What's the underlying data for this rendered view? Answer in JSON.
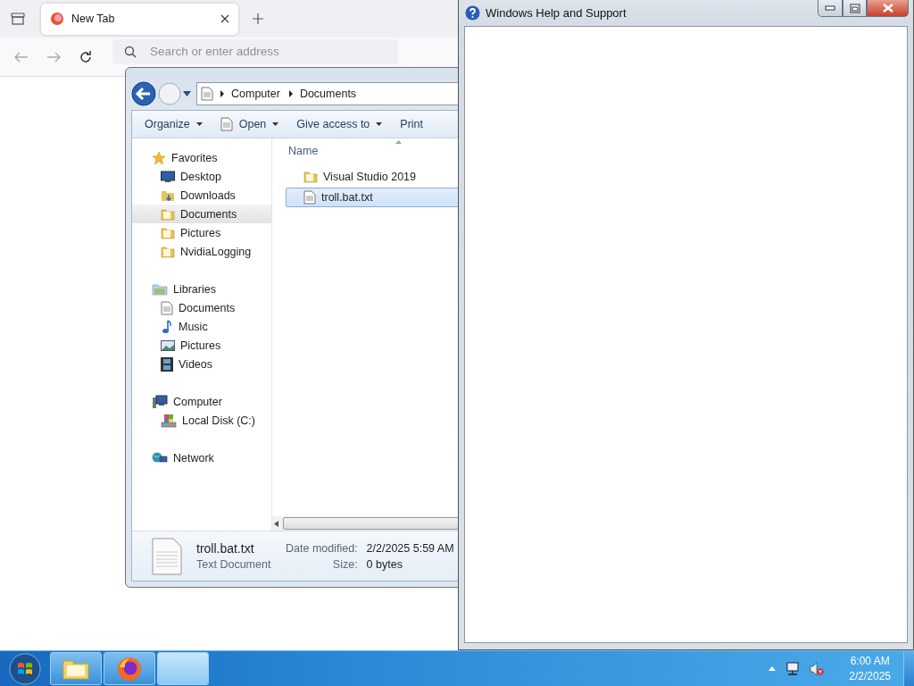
{
  "browser": {
    "tabs": [
      {
        "label": "New Tab",
        "selected": true
      }
    ],
    "address_bar": {
      "placeholder": "Search or enter address"
    }
  },
  "explorer": {
    "breadcrumb": [
      "Computer",
      "Documents"
    ],
    "toolbar": [
      {
        "label": "Organize",
        "dropdown": true
      },
      {
        "label": "Open",
        "dropdown": true
      },
      {
        "label": "Give access to",
        "dropdown": true
      },
      {
        "label": "Print",
        "dropdown": false
      }
    ],
    "nav": [
      {
        "label": "Favorites",
        "children": [
          {
            "label": "Desktop",
            "selected": false
          },
          {
            "label": "Downloads",
            "selected": false
          },
          {
            "label": "Documents",
            "selected": true
          },
          {
            "label": "Pictures",
            "selected": false
          },
          {
            "label": "NvidiaLogging",
            "selected": false
          }
        ]
      },
      {
        "label": "Libraries",
        "children": [
          {
            "label": "Documents",
            "selected": false
          },
          {
            "label": "Music",
            "selected": false
          },
          {
            "label": "Pictures",
            "selected": false
          },
          {
            "label": "Videos",
            "selected": false
          }
        ]
      },
      {
        "label": "Computer",
        "children": [
          {
            "label": "Local Disk (C:)",
            "selected": false
          }
        ]
      },
      {
        "label": "Network"
      }
    ],
    "file_list": {
      "column": "Name",
      "files": [
        {
          "name": "Visual Studio 2019",
          "kind": "folder",
          "selected": false
        },
        {
          "name": "troll.bat.txt",
          "kind": "file",
          "selected": true
        }
      ]
    },
    "details": {
      "name": "troll.bat.txt",
      "type": "Text Document",
      "fields": [
        {
          "label": "Date modified:",
          "value": "2/2/2025 5:59 AM"
        },
        {
          "label": "Size:",
          "value": "0 bytes"
        }
      ]
    }
  },
  "help_window": {
    "title": "Windows Help and Support"
  },
  "taskbar": {
    "time": "6:00 AM",
    "date": "2/2/2025"
  }
}
